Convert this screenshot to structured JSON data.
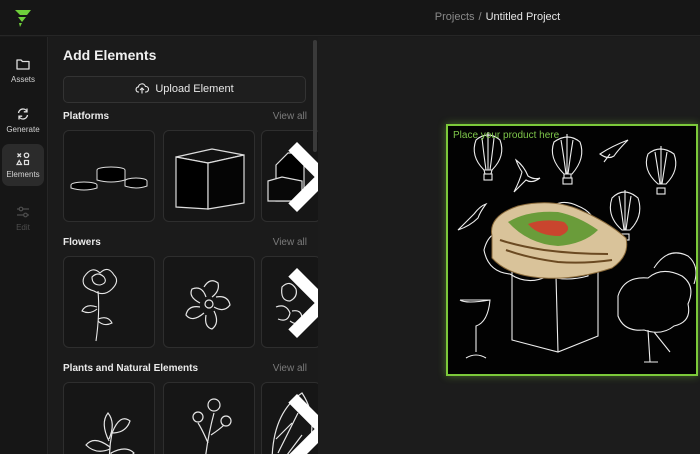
{
  "header": {
    "breadcrumb_parent": "Projects",
    "breadcrumb_separator": "/",
    "breadcrumb_current": "Untitled Project"
  },
  "rail": {
    "items": [
      {
        "label": "Assets",
        "icon": "folder-icon"
      },
      {
        "label": "Generate",
        "icon": "refresh-icon"
      },
      {
        "label": "Elements",
        "icon": "shapes-icon",
        "active": true
      },
      {
        "label": "Edit",
        "icon": "sliders-icon",
        "disabled": true
      }
    ]
  },
  "panel": {
    "title": "Add Elements",
    "upload_label": "Upload Element",
    "view_all_label": "View all",
    "sections": [
      {
        "title": "Platforms"
      },
      {
        "title": "Flowers"
      },
      {
        "title": "Plants and Natural Elements"
      }
    ]
  },
  "canvas": {
    "placeholder": "Place your product here"
  },
  "colors": {
    "accent": "#7cc93a",
    "background": "#1a1a1a",
    "panel": "#1b1b1b"
  }
}
